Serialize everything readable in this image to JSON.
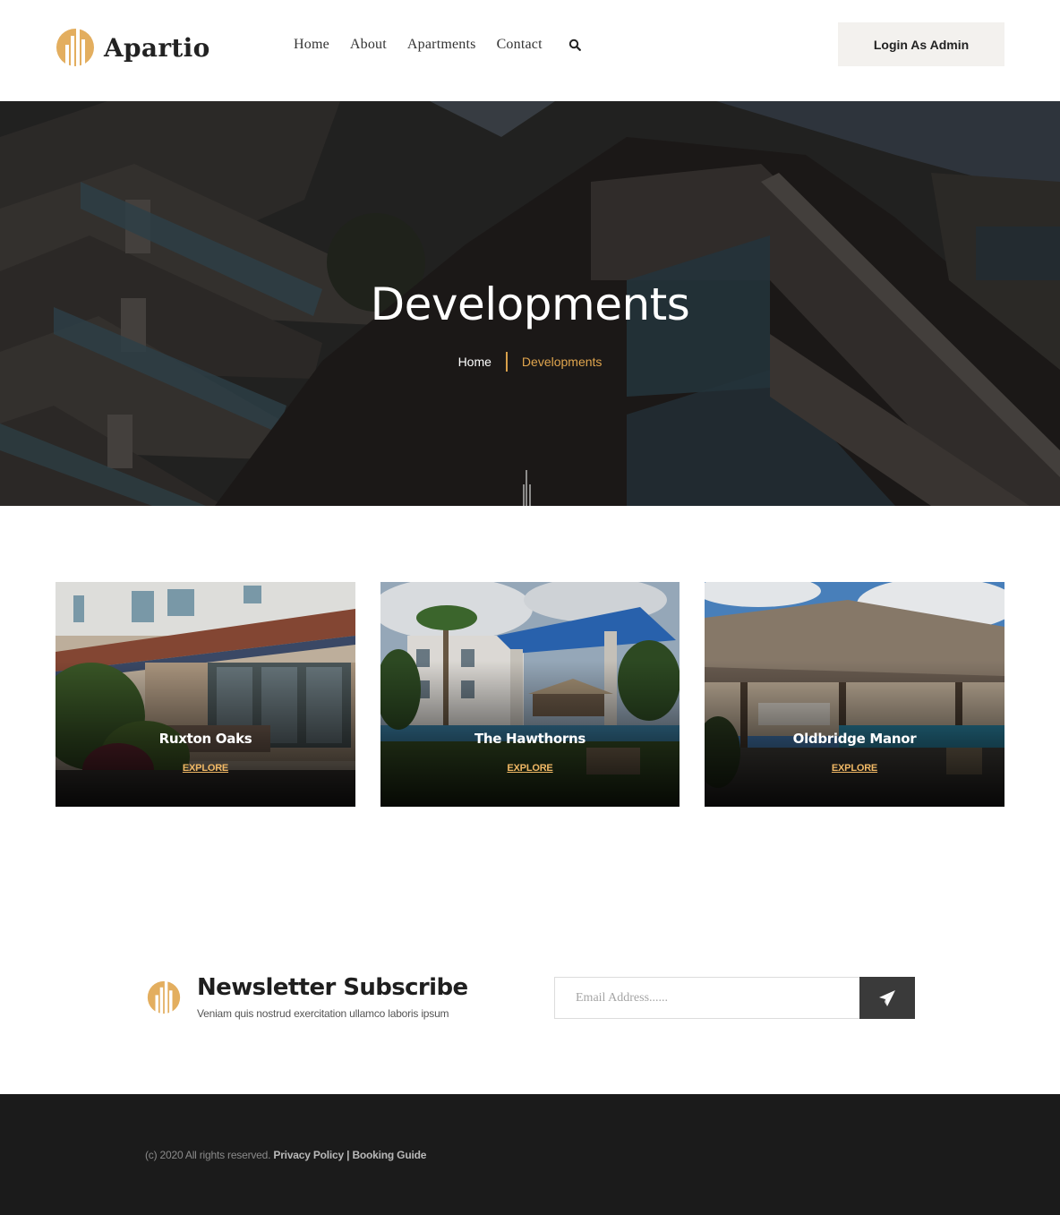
{
  "header": {
    "brand": "Apartio",
    "nav": [
      "Home",
      "About",
      "Apartments",
      "Contact"
    ],
    "login_label": "Login As Admin"
  },
  "hero": {
    "title": "Developments",
    "breadcrumb_home": "Home",
    "breadcrumb_current": "Developments"
  },
  "cards": [
    {
      "title": "Ruxton Oaks",
      "link": "EXPLORE"
    },
    {
      "title": "The Hawthorns",
      "link": "EXPLORE"
    },
    {
      "title": "Oldbridge Manor",
      "link": "EXPLORE"
    }
  ],
  "newsletter": {
    "title": "Newsletter Subscribe",
    "subtitle": "Veniam quis nostrud exercitation ullamco laboris ipsum",
    "placeholder": "Email Address......"
  },
  "footer": {
    "copyright": "(c) 2020 All rights reserved.",
    "privacy": "Privacy Policy",
    "separator": "|",
    "booking": "Booking Guide"
  },
  "colors": {
    "accent": "#e0a54e",
    "dark": "#1b1b1b",
    "button_bg": "#f3f1ee"
  }
}
